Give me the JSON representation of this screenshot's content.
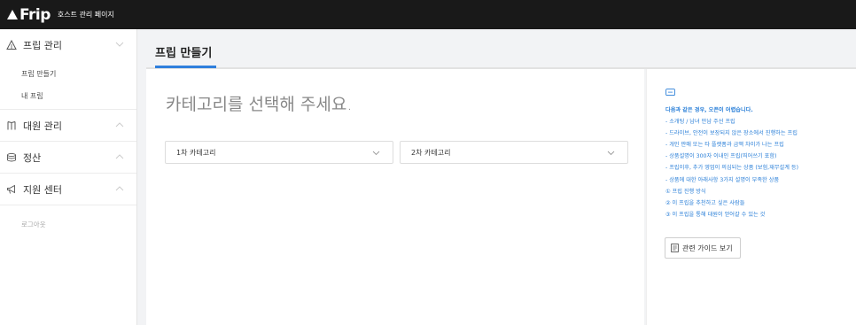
{
  "topbar": {
    "brand": "Frip",
    "subtitle": "호스트 관리 페이지"
  },
  "sidebar": {
    "sections": [
      {
        "label": "프립 관리",
        "icon": "triangle-outline-icon",
        "expanded": true,
        "items": [
          "프립 만들기",
          "내 프립"
        ]
      },
      {
        "label": "대원 관리",
        "icon": "book-icon",
        "expanded": false
      },
      {
        "label": "정산",
        "icon": "coins-icon",
        "expanded": false
      },
      {
        "label": "지원 센터",
        "icon": "megaphone-icon",
        "expanded": false
      }
    ],
    "logout": "로그아웃"
  },
  "page": {
    "title": "프립 만들기",
    "accent_color": "#2f7fdc"
  },
  "main": {
    "heading": "카테고리를 선택해 주세요.",
    "category1_placeholder": "1차 카테고리",
    "category2_placeholder": "2차 카테고리"
  },
  "notice": {
    "title": "다음과 같은 경우, 오픈이 어렵습니다.",
    "lines": [
      "- 소개팅 / 남녀 만남 주선 프립",
      "- 드라이브, 안전이 보장되지 않은 장소에서 진행하는 프립",
      "- 개인 판매 또는 타 플랫폼과 금액 차이가 나는 프립",
      "- 상품설명이 300자 이내인 프립(띄어쓰기 포함)",
      "- 프립이후, 추가 영업이 의심되는 상품 (보험,재무설계 등)",
      "- 상품에 대한 아래사항 3가지 설명이 부족한 상품",
      "① 프립 진행 방식",
      "② 이 프립을 추천하고 싶은 사람들",
      "③ 이 프립을 통해 대원이 얻어갈 수 있는 것"
    ],
    "color": "#2a7fd8"
  },
  "guide_button": "관련 가이드 보기"
}
